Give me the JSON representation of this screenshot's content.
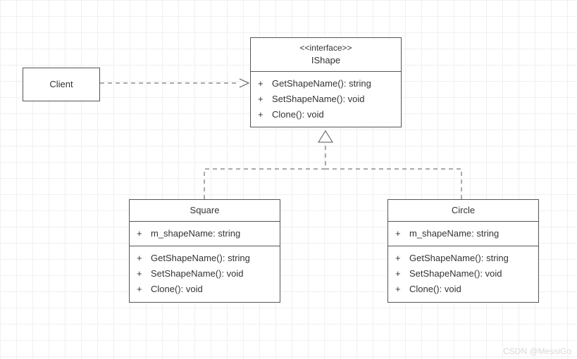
{
  "client": {
    "name": "Client"
  },
  "ishape": {
    "stereotype": "<<interface>>",
    "name": "IShape",
    "methods": [
      {
        "vis": "+",
        "sig": "GetShapeName(): string"
      },
      {
        "vis": "+",
        "sig": "SetShapeName(): void"
      },
      {
        "vis": "+",
        "sig": "Clone(): void"
      }
    ]
  },
  "square": {
    "name": "Square",
    "attrs": [
      {
        "vis": "+",
        "sig": "m_shapeName: string"
      }
    ],
    "methods": [
      {
        "vis": "+",
        "sig": "GetShapeName(): string"
      },
      {
        "vis": "+",
        "sig": "SetShapeName(): void"
      },
      {
        "vis": "+",
        "sig": "Clone(): void"
      }
    ]
  },
  "circle": {
    "name": "Circle",
    "attrs": [
      {
        "vis": "+",
        "sig": "m_shapeName: string"
      }
    ],
    "methods": [
      {
        "vis": "+",
        "sig": "GetShapeName(): string"
      },
      {
        "vis": "+",
        "sig": "SetShapeName(): void"
      },
      {
        "vis": "+",
        "sig": "Clone(): void"
      }
    ]
  },
  "watermark": "CSDN @MessiGo"
}
